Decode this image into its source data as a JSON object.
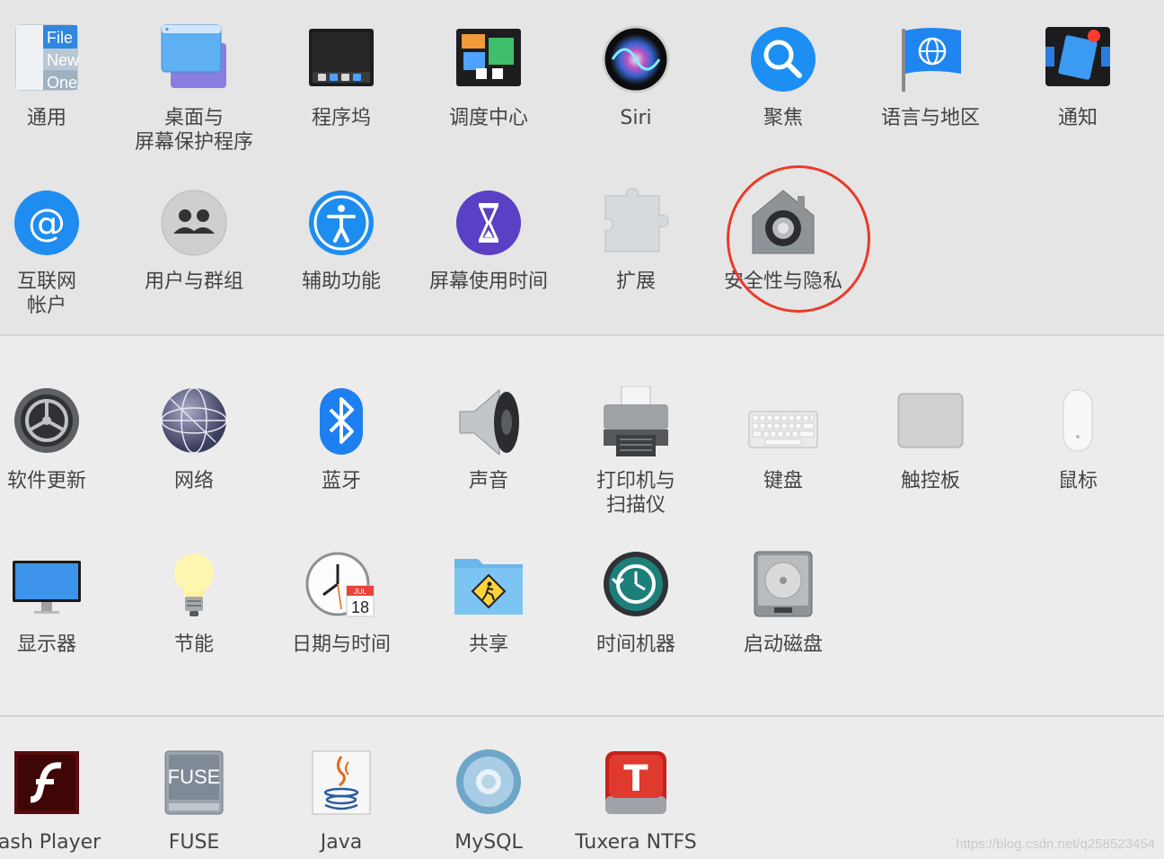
{
  "row1": [
    {
      "label": "通用",
      "icon": "general-icon"
    },
    {
      "label": "桌面与\n屏幕保护程序",
      "icon": "desktop-screensaver-icon"
    },
    {
      "label": "程序坞",
      "icon": "dock-icon"
    },
    {
      "label": "调度中心",
      "icon": "mission-control-icon"
    },
    {
      "label": "Siri",
      "icon": "siri-icon"
    },
    {
      "label": "聚焦",
      "icon": "spotlight-icon"
    },
    {
      "label": "语言与地区",
      "icon": "language-region-icon"
    },
    {
      "label": "通知",
      "icon": "notifications-icon"
    }
  ],
  "row2": [
    {
      "label": "互联网\n帐户",
      "icon": "internet-accounts-icon"
    },
    {
      "label": "用户与群组",
      "icon": "users-groups-icon"
    },
    {
      "label": "辅助功能",
      "icon": "accessibility-icon"
    },
    {
      "label": "屏幕使用时间",
      "icon": "screen-time-icon"
    },
    {
      "label": "扩展",
      "icon": "extensions-icon"
    },
    {
      "label": "安全性与隐私",
      "icon": "security-privacy-icon"
    }
  ],
  "row3": [
    {
      "label": "软件更新",
      "icon": "software-update-icon"
    },
    {
      "label": "网络",
      "icon": "network-icon"
    },
    {
      "label": "蓝牙",
      "icon": "bluetooth-icon"
    },
    {
      "label": "声音",
      "icon": "sound-icon"
    },
    {
      "label": "打印机与\n扫描仪",
      "icon": "printers-scanners-icon"
    },
    {
      "label": "键盘",
      "icon": "keyboard-icon"
    },
    {
      "label": "触控板",
      "icon": "trackpad-icon"
    },
    {
      "label": "鼠标",
      "icon": "mouse-icon"
    }
  ],
  "row4": [
    {
      "label": "显示器",
      "icon": "displays-icon"
    },
    {
      "label": "节能",
      "icon": "energy-saver-icon"
    },
    {
      "label": "日期与时间",
      "icon": "date-time-icon"
    },
    {
      "label": "共享",
      "icon": "sharing-icon"
    },
    {
      "label": "时间机器",
      "icon": "time-machine-icon"
    },
    {
      "label": "启动磁盘",
      "icon": "startup-disk-icon"
    }
  ],
  "row5": [
    {
      "label": "lash Player",
      "icon": "flash-player-icon"
    },
    {
      "label": "FUSE",
      "icon": "fuse-icon"
    },
    {
      "label": "Java",
      "icon": "java-icon"
    },
    {
      "label": "MySQL",
      "icon": "mysql-icon"
    },
    {
      "label": "Tuxera NTFS",
      "icon": "tuxera-ntfs-icon"
    }
  ],
  "icon_text": {
    "general_file": "File",
    "general_new": "New",
    "general_one": "One",
    "fuse": "FUSE",
    "calendar_month": "JUL",
    "calendar_day": "18",
    "tuxera": "T"
  },
  "highlight": {
    "target": "安全性与隐私",
    "color": "#ea3a2a"
  },
  "watermark": "https://blog.csdn.net/q258523454"
}
